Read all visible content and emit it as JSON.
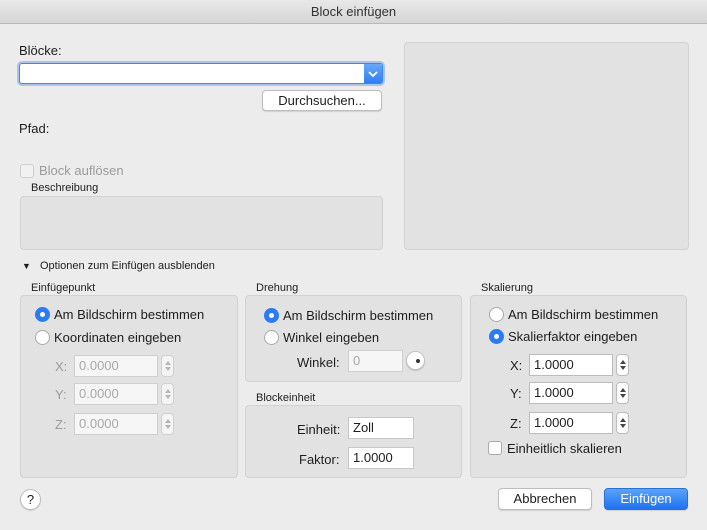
{
  "window": {
    "title": "Block einfügen"
  },
  "blocks": {
    "label": "Blöcke:",
    "value": "",
    "browse_label": "Durchsuchen..."
  },
  "path": {
    "label": "Pfad:"
  },
  "explode": {
    "label": "Block auflösen",
    "checked": false,
    "disabled": true
  },
  "description": {
    "label": "Beschreibung"
  },
  "options_toggle": {
    "arrow": "▼",
    "label": "Optionen zum Einfügen ausblenden"
  },
  "insertion": {
    "title": "Einfügepunkt",
    "radio_screen": "Am Bildschirm bestimmen",
    "radio_coords": "Koordinaten eingeben",
    "selected": "screen",
    "x_label": "X:",
    "x_value": "0.0000",
    "y_label": "Y:",
    "y_value": "0.0000",
    "z_label": "Z:",
    "z_value": "0.0000"
  },
  "rotation": {
    "title": "Drehung",
    "radio_screen": "Am Bildschirm bestimmen",
    "radio_angle": "Winkel eingeben",
    "selected": "screen",
    "angle_label": "Winkel:",
    "angle_value": "0"
  },
  "block_unit": {
    "title": "Blockeinheit",
    "unit_label": "Einheit:",
    "unit_value": "Zoll",
    "factor_label": "Faktor:",
    "factor_value": "1.0000"
  },
  "scale": {
    "title": "Skalierung",
    "radio_screen": "Am Bildschirm bestimmen",
    "radio_factor": "Skalierfaktor eingeben",
    "selected": "factor",
    "x_label": "X:",
    "x_value": "1.0000",
    "y_label": "Y:",
    "y_value": "1.0000",
    "z_label": "Z:",
    "z_value": "1.0000",
    "uniform_label": "Einheitlich skalieren",
    "uniform_checked": false
  },
  "footer": {
    "help_label": "?",
    "cancel_label": "Abbrechen",
    "insert_label": "Einfügen"
  },
  "colors": {
    "accent": "#2b7bf2",
    "background": "#ececec",
    "panel": "#e2e2e2"
  }
}
